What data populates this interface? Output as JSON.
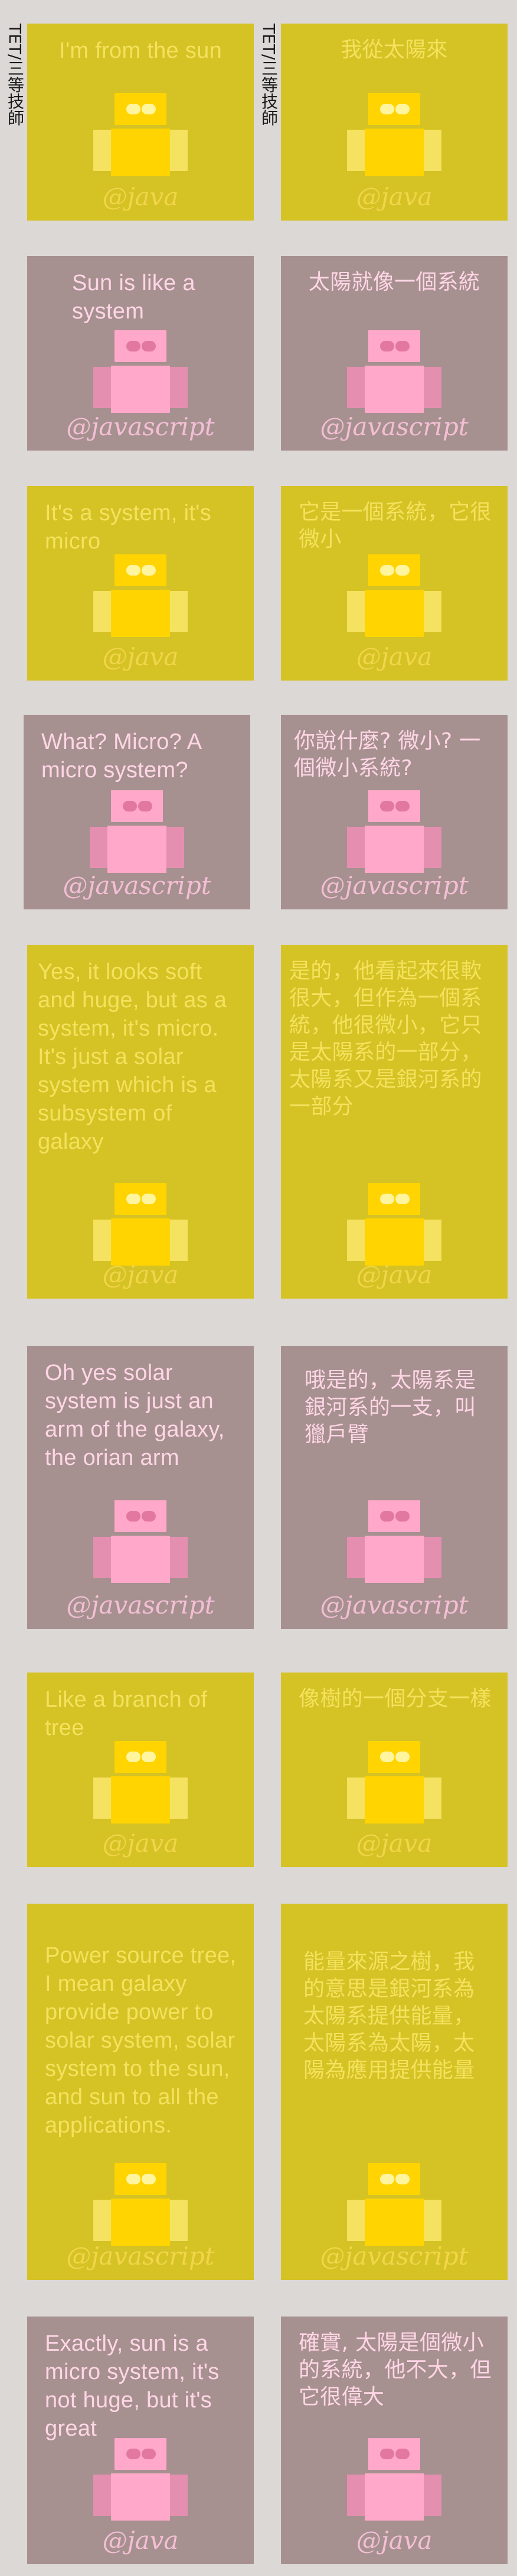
{
  "side_label": "TET/三等技師",
  "colors": {
    "background": "#dcd8d6",
    "yellow_panel": "#d5c224",
    "mauve_panel": "#a79090",
    "yellow_robot": "#ffd400",
    "pink_robot": "#ffa8c9"
  },
  "rows": [
    {
      "left": {
        "text": "I'm from the sun",
        "handle": "@java"
      },
      "right": {
        "text": "我從太陽來",
        "handle": "@java"
      }
    },
    {
      "left": {
        "text": "Sun is like a system",
        "handle": "@javascript"
      },
      "right": {
        "text": "太陽就像一個系統",
        "handle": "@javascript"
      }
    },
    {
      "left": {
        "text": "It's a system, it's micro",
        "handle": "@java"
      },
      "right": {
        "text": "它是一個系統，它很微小",
        "handle": "@java"
      }
    },
    {
      "left": {
        "text": "What? Micro? A micro system?",
        "handle": "@javascript"
      },
      "right": {
        "text": "你說什麼? 微小? 一個微小系統?",
        "handle": "@javascript"
      }
    },
    {
      "left": {
        "text": "Yes, it looks soft and huge, but as a system, it's micro. It's just a solar system which is a subsystem of galaxy",
        "handle": "@java"
      },
      "right": {
        "text": "是的，他看起來很軟很大，但作為一個系統，他很微小，它只是太陽系的一部分，太陽系又是銀河系的一部分",
        "handle": "@java"
      }
    },
    {
      "left": {
        "text": "Oh yes solar system is just an arm of the galaxy, the orian arm",
        "handle": "@javascript"
      },
      "right": {
        "text": "哦是的，太陽系是銀河系的一支，叫獵戶臂",
        "handle": "@javascript"
      }
    },
    {
      "left": {
        "text": "Like a branch of tree",
        "handle": "@java"
      },
      "right": {
        "text": "像樹的一個分支一樣",
        "handle": "@java"
      }
    },
    {
      "left": {
        "text": "Power source tree, I mean galaxy provide power to solar system, solar system to the sun, and sun to all the applications.",
        "handle": "@javascript"
      },
      "right": {
        "text": "能量來源之樹，我的意思是銀河系為太陽系提供能量，太陽系為太陽，太陽為應用提供能量",
        "handle": "@javascript"
      }
    },
    {
      "left": {
        "text": "Exactly, sun is a micro system, it's not huge, but it's great",
        "handle": "@java"
      },
      "right": {
        "text": "確實, 太陽是個微小的系統，他不大，但它很偉大",
        "handle": "@java"
      }
    }
  ]
}
